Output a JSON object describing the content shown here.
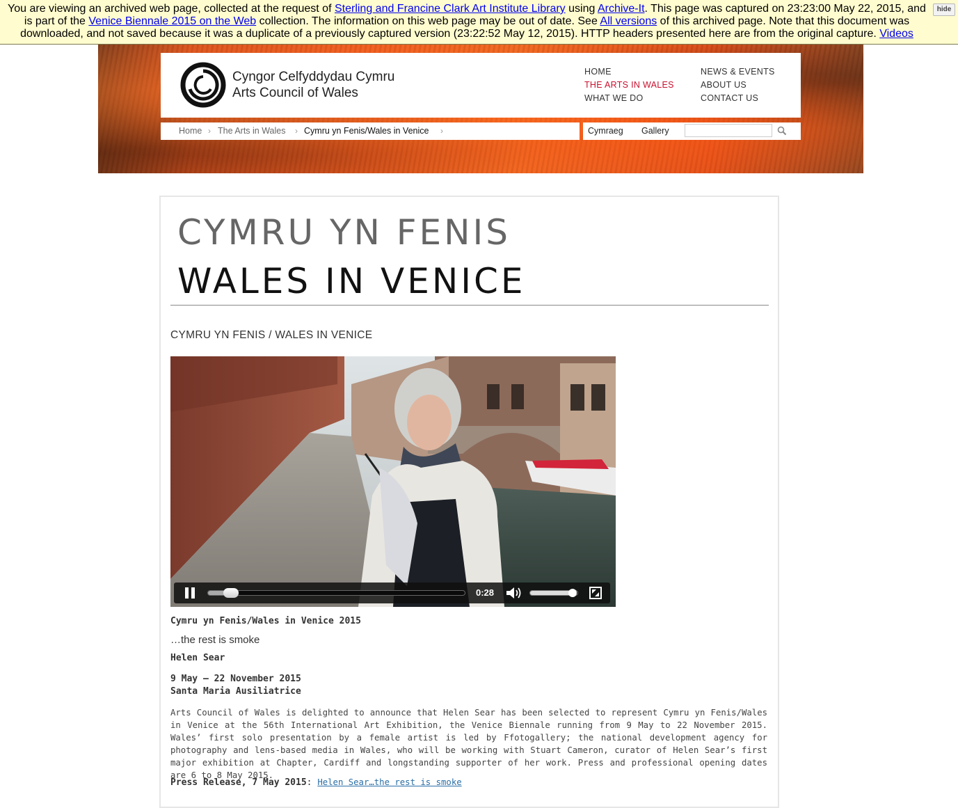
{
  "archive_banner": {
    "text_1": "You are viewing an archived web page, collected at the request of ",
    "link_library": "Sterling and Francine Clark Art Institute Library",
    "text_2": " using ",
    "link_archiveit": "Archive-It",
    "text_3": ". This page was captured on 23:23:00 May 22, 2015, and is part of the ",
    "link_collection": "Venice Biennale 2015 on the Web",
    "text_4": " collection. The information on this web page may be out of date. See ",
    "link_versions": "All versions",
    "text_5": " of this archived page. Note that this document was downloaded, and not saved because it was a duplicate of a previously captured version (23:22:52 May 12, 2015). HTTP headers presented here are from the original capture. ",
    "link_videos": "Videos",
    "hide_label": "hide"
  },
  "header": {
    "logo_welsh": "Cyngor Celfyddydau Cymru",
    "logo_english": "Arts Council of Wales",
    "nav": [
      "HOME",
      "THE ARTS IN WALES",
      "WHAT WE DO",
      "NEWS & EVENTS",
      "ABOUT US",
      "CONTACT US"
    ],
    "active_nav": "THE ARTS IN WALES",
    "accent_color": "#c8102e",
    "breadcrumb": [
      "Home",
      "The Arts in Wales",
      "Cymru yn Fenis/Wales in Venice"
    ],
    "language_link": "Cymraeg",
    "gallery_link": "Gallery",
    "search_value": ""
  },
  "main": {
    "title_welsh": "CYMRU YN FENIS",
    "title_english": "WALES IN VENICE",
    "section_heading": "CYMRU YN FENIS / WALES IN VENICE",
    "video": {
      "time": "0:28",
      "progress_fraction": 0.09,
      "volume_fraction": 0.9,
      "state": "playing"
    },
    "event_title": "Cymru yn Fenis/Wales in Venice 2015",
    "subtitle": "…the rest is smoke",
    "artist": "Helen Sear",
    "dates": "9 May – 22 November 2015",
    "venue": "Santa Maria Ausiliatrice",
    "paragraph": "Arts Council of Wales is delighted to announce that Helen Sear has been selected to represent Cymru yn Fenis/Wales in Venice at the 56th International Art Exhibition, the Venice Biennale running from 9 May to 22 November 2015. Wales’ first solo presentation by a female artist is led by Ffotogallery; the national development agency for photography and lens-based media in Wales, who will be working with Stuart Cameron, curator of Helen Sear’s first major exhibition at Chapter, Cardiff and longstanding supporter of her work. Press and professional opening dates are 6 to 8 May 2015.",
    "press_label": "Press Release, 7 May 2015",
    "press_sep": ": ",
    "press_link": "Helen Sear…the rest is smoke"
  }
}
